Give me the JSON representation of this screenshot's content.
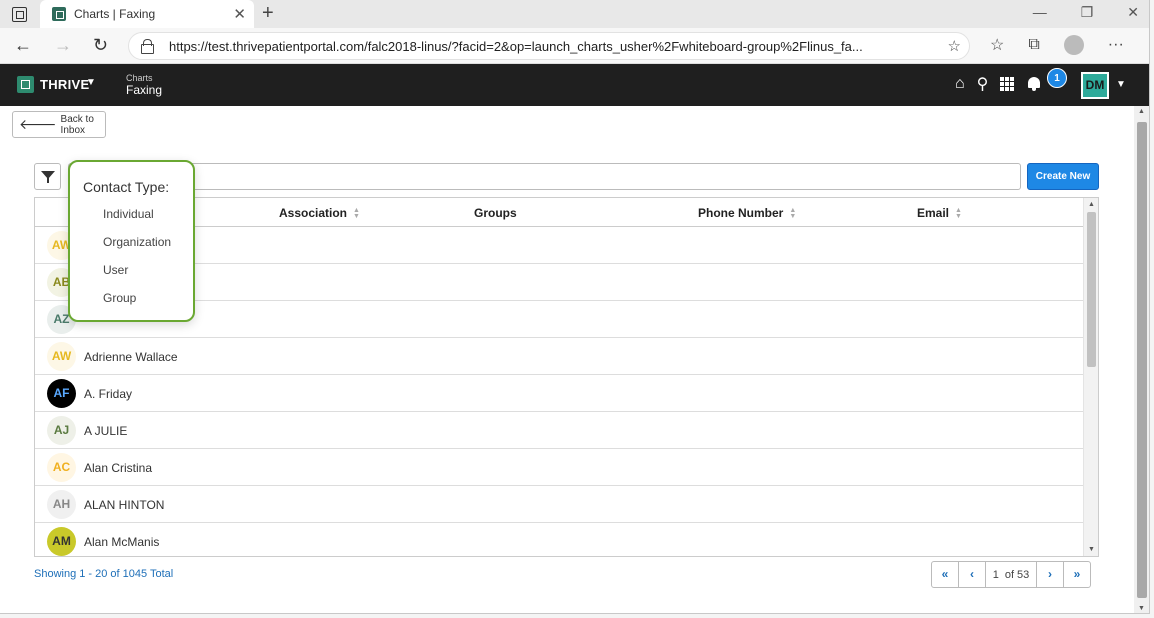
{
  "browser": {
    "tab_title": "Charts | Faxing",
    "url": "https://test.thrivepatientportal.com/falc2018-linus/?facid=2&op=launch_charts_usher%2Fwhiteboard-group%2Flinus_fa..."
  },
  "header": {
    "brand": "THRIVE",
    "module_sub": "Charts",
    "module_main": "Faxing",
    "notification_count": "1",
    "user_initials": "DM"
  },
  "toolbar": {
    "back_label": "Back to Inbox",
    "search_placeholder": "",
    "create_label": "Create New"
  },
  "table": {
    "columns": [
      "Association",
      "Groups",
      "Phone Number",
      "Email"
    ],
    "rows": [
      {
        "initials": "AW",
        "name": "",
        "bg": "#fdf7e6",
        "fg": "#e6b820"
      },
      {
        "initials": "AB",
        "name": "",
        "bg": "#f2f3e3",
        "fg": "#8a8a1e"
      },
      {
        "initials": "AZ",
        "name": "",
        "bg": "#e9eeec",
        "fg": "#4a7a6a"
      },
      {
        "initials": "AW",
        "name": "Adrienne Wallace",
        "bg": "#fdf7e6",
        "fg": "#e6b820"
      },
      {
        "initials": "AF",
        "name": "A. Friday",
        "bg": "#000000",
        "fg": "#5aa9ff"
      },
      {
        "initials": "AJ",
        "name": "A JULIE",
        "bg": "#eef0e8",
        "fg": "#5a7a40"
      },
      {
        "initials": "AC",
        "name": "Alan Cristina",
        "bg": "#fff6e3",
        "fg": "#f0b020"
      },
      {
        "initials": "AH",
        "name": "ALAN HINTON",
        "bg": "#f0f0f0",
        "fg": "#888888"
      },
      {
        "initials": "AM",
        "name": "Alan McManis",
        "bg": "#c9c92a",
        "fg": "#333333"
      }
    ]
  },
  "footer": {
    "showing": "Showing 1 - 20 of 1045 Total",
    "page_current": "1",
    "page_of": "of 53"
  },
  "popover": {
    "title": "Contact Type:",
    "options": [
      "Individual",
      "Organization",
      "User",
      "Group"
    ]
  }
}
